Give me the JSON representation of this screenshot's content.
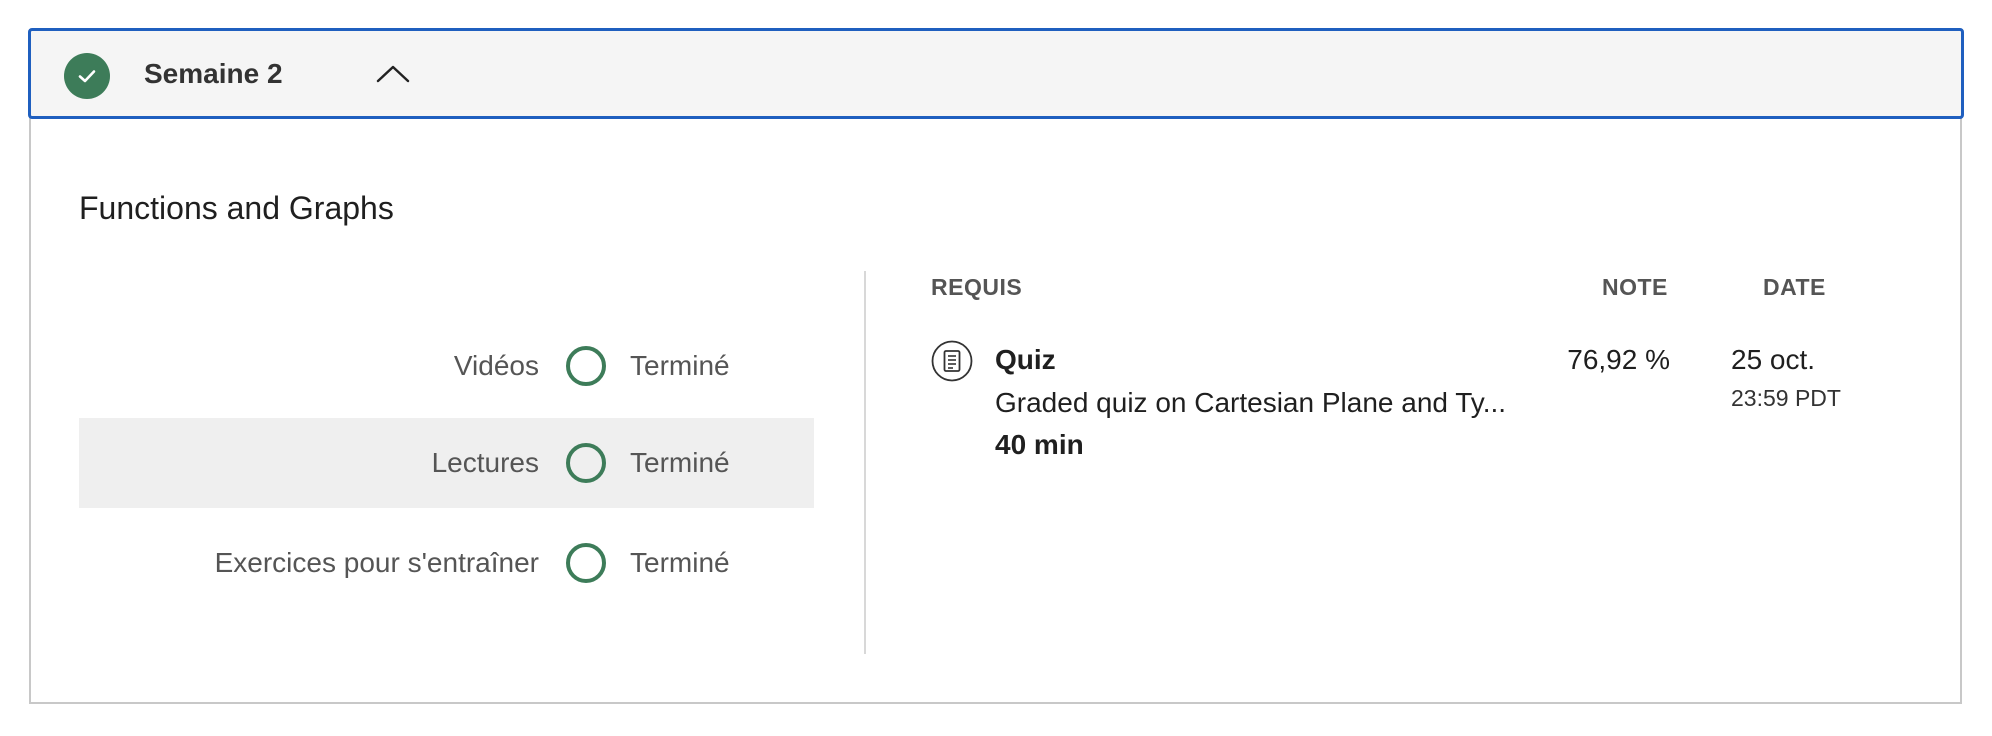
{
  "week": {
    "title": "Semaine 2",
    "completed": true
  },
  "module": {
    "title": "Functions and Graphs"
  },
  "progress": [
    {
      "label": "Vidéos",
      "status": "Terminé"
    },
    {
      "label": "Lectures",
      "status": "Terminé"
    },
    {
      "label": "Exercices pour s'entraîner",
      "status": "Terminé"
    }
  ],
  "table": {
    "headers": {
      "required": "REQUIS",
      "grade": "NOTE",
      "date": "DATE"
    },
    "rows": [
      {
        "name": "Quiz",
        "description": "Graded quiz on Cartesian Plane and Ty...",
        "duration": "40 min",
        "grade": "76,92 %",
        "date": "25 oct.",
        "time": "23:59 PDT",
        "icon": "quiz-document-icon"
      }
    ]
  },
  "colors": {
    "accent_blue": "#1f5fbf",
    "success_green": "#3d7c59"
  }
}
